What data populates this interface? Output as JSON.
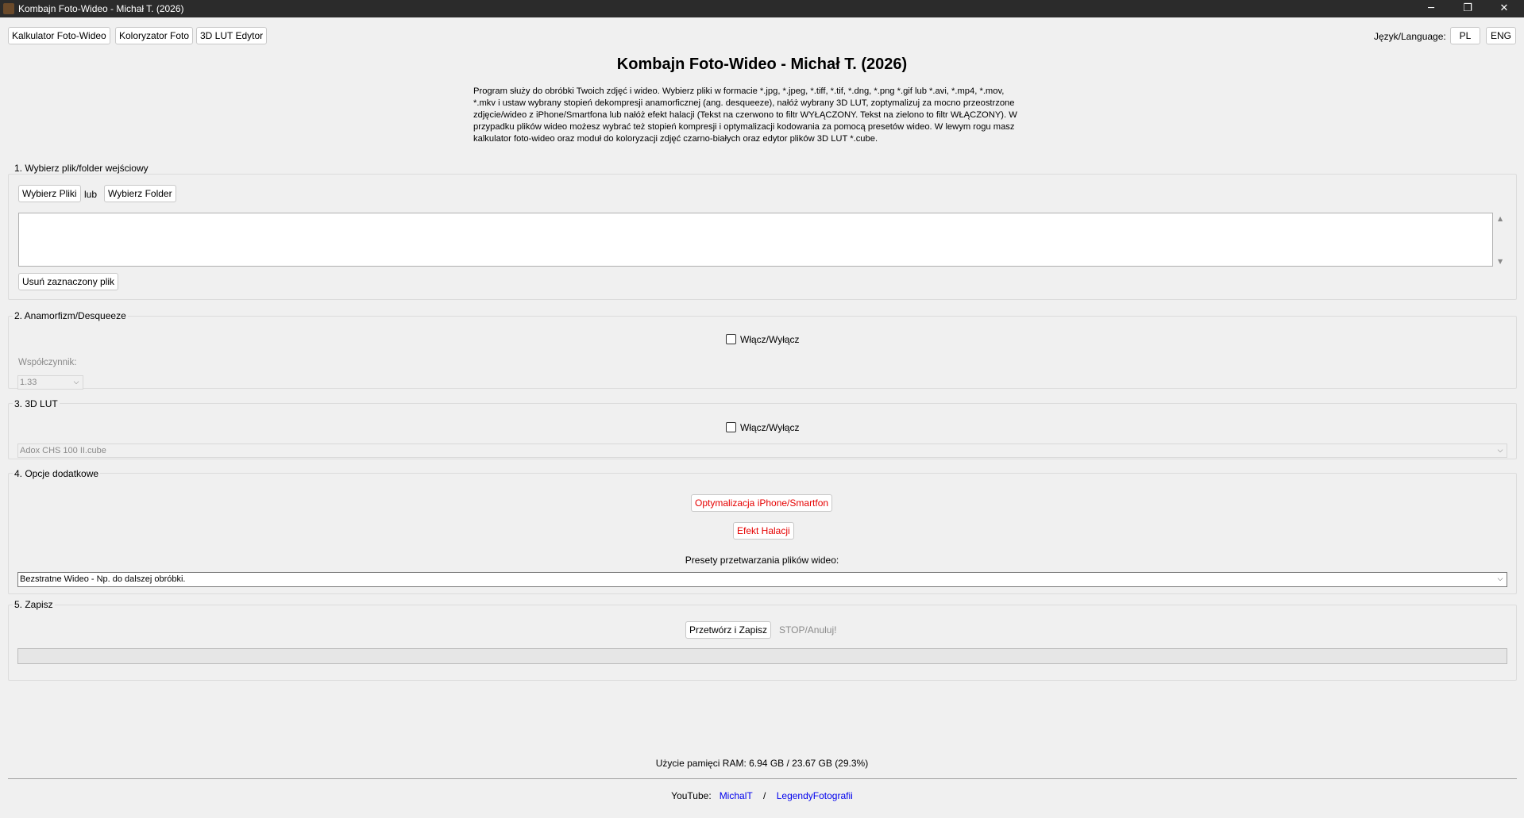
{
  "window": {
    "title": "Kombajn Foto-Wideo - Michał T. (2026)",
    "controls": {
      "minimize": "─",
      "restore": "❐",
      "close": "✕"
    }
  },
  "toolbar": {
    "calculator": "Kalkulator Foto-Wideo",
    "colorizer": "Koloryzator Foto",
    "lut_editor": "3D LUT Edytor",
    "language_label": "Język/Language:",
    "lang_pl": "PL",
    "lang_eng": "ENG"
  },
  "header": {
    "title": "Kombajn Foto-Wideo - Michał T. (2026)",
    "description_lines": [
      "Program służy do obróbki Twoich zdjęć i wideo. Wybierz pliki w formacie *.jpg, *.jpeg, *.tiff, *.tif, *.dng, *.png *.gif lub *.avi, *.mp4, *.mov,",
      "*.mkv i ustaw wybrany stopień dekompresji anamorficznej (ang. desqueeze), nałóż wybrany 3D LUT, zoptymalizuj za mocno przeostrzone",
      "zdjęcie/wideo z iPhone/Smartfona lub nałóż efekt halacji (Tekst na czerwono to filtr WYŁĄCZONY. Tekst na zielono to filtr WŁĄCZONY). W",
      "przypadku plików wideo możesz wybrać też stopień kompresji i optymalizacji kodowania za pomocą presetów wideo. W lewym rogu masz",
      "kalkulator foto-wideo oraz moduł do koloryzacji zdjęć czarno-białych oraz edytor plików 3D LUT *.cube."
    ]
  },
  "section1": {
    "legend": "1. Wybierz plik/folder wejściowy",
    "choose_files": "Wybierz Pliki",
    "or_label": "lub",
    "choose_folder": "Wybierz Folder",
    "remove_selected": "Usuń zaznaczony plik",
    "scroll_up": "▲",
    "scroll_down": "▼"
  },
  "section2": {
    "legend": "2. Anamorfizm/Desqueeze",
    "toggle_label": "Włącz/Wyłącz",
    "factor_label": "Współczynnik:",
    "factor_value": "1.33"
  },
  "section3": {
    "legend": "3. 3D LUT",
    "toggle_label": "Włącz/Wyłącz",
    "lut_value": "Adox CHS 100 II.cube"
  },
  "section4": {
    "legend": "4. Opcje dodatkowe",
    "iphone_opt": "Optymalizacja iPhone/Smartfon",
    "halation": "Efekt Halacji",
    "presets_label": "Presety przetwarzania plików wideo:",
    "preset_value": "Bezstratne Wideo - Np. do dalszej obróbki."
  },
  "section5": {
    "legend": "5. Zapisz",
    "process_save": "Przetwórz i Zapisz",
    "stop_cancel": "STOP/Anuluj!",
    "progress": 0
  },
  "footer": {
    "ram_usage": "Użycie pamięci RAM: 6.94 GB / 23.67 GB (29.3%)",
    "youtube_label": "YouTube:",
    "link1": "MichalT",
    "separator": "/",
    "link2": "LegendyFotografii"
  },
  "icons": {
    "dropdown": "chevron-down",
    "check": "checkbox-unchecked"
  },
  "colors": {
    "filter_off": "#e60000",
    "link": "#0000ee",
    "titlebar": "#2b2b2b"
  }
}
